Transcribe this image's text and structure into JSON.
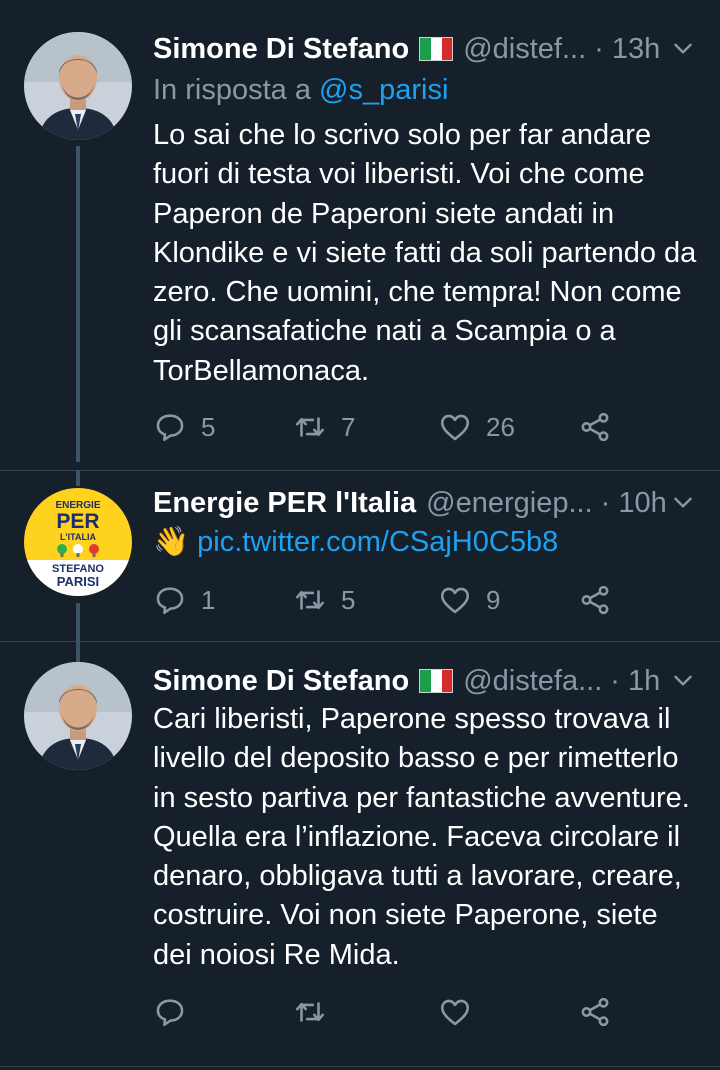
{
  "tweets": [
    {
      "author_name": "Simone Di Stefano",
      "handle": "@distef...",
      "time": "· 13h",
      "reply_prefix": "In risposta a ",
      "reply_mention": "@s_parisi",
      "text": "Lo sai che lo scrivo solo per far andare fuori di testa voi liberisti. Voi che come Paperon de Paperoni siete andati in Klondike e vi siete fatti da soli partendo da zero. Che uomini, che tempra! Non come gli scansafatiche nati a Scampia o a TorBellamonaca.",
      "replies": "5",
      "retweets": "7",
      "likes": "26"
    },
    {
      "author_name": "Energie PER l'Italia",
      "handle": "@energiep...",
      "time": "· 10h",
      "emoji": "👋",
      "link": "pic.twitter.com/CSajH0C5b8",
      "replies": "1",
      "retweets": "5",
      "likes": "9",
      "avatar_text": {
        "line1": "ENERGIE",
        "line2": "PER",
        "line3": "L'ITALIA",
        "line4": "STEFANO",
        "line5": "PARISI"
      }
    },
    {
      "author_name": "Simone Di Stefano",
      "handle": "@distefa...",
      "time": "· 1h",
      "text": "Cari liberisti, Paperone spesso trovava il livello del deposito basso e per rimetterlo in sesto partiva per fantastiche avventure. Quella era l’inflazione. Faceva circolare il denaro, obbligava tutti a lavorare, creare, costruire. Voi non siete Paperone, siete dei noiosi Re Mida.",
      "replies": "",
      "retweets": "",
      "likes": ""
    }
  ],
  "colors": {
    "background": "#15202b",
    "secondary_text": "#8899a6",
    "link": "#1da1f2",
    "thread_line": "#3d5466"
  },
  "icons": [
    "reply-icon",
    "retweet-icon",
    "like-icon",
    "share-icon",
    "chevron-down-icon",
    "italy-flag-icon"
  ]
}
